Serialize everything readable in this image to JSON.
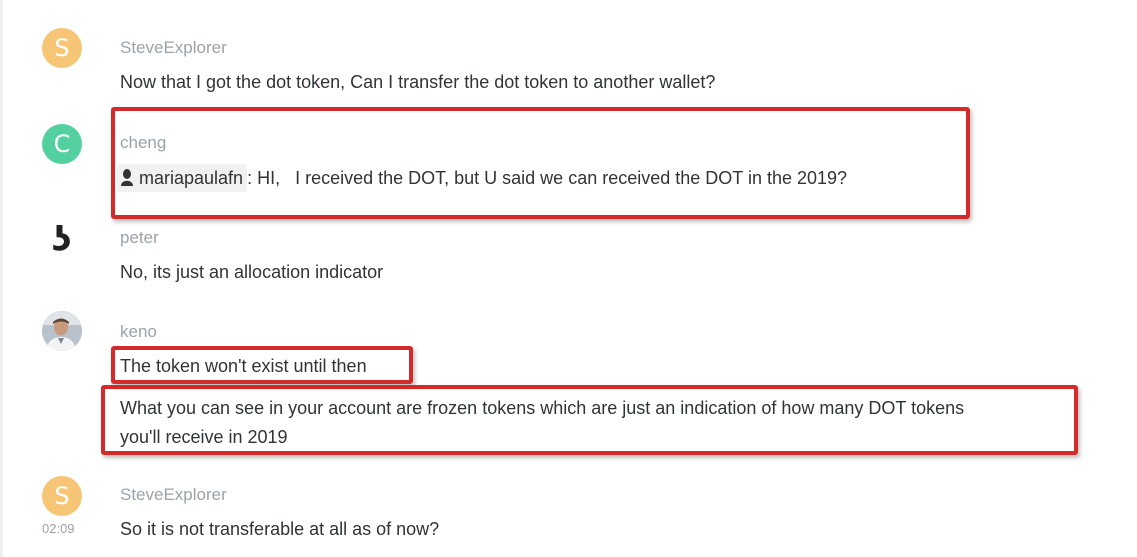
{
  "messages": [
    {
      "user": "SteveExplorer",
      "avatar_letter": "S",
      "lines": [
        "Now that I got the dot token, Can I transfer the dot token to another wallet?"
      ]
    },
    {
      "user": "cheng",
      "avatar_letter": "C",
      "mention": "mariapaulafn",
      "text": ": HI,   I received the DOT, but U said we can received the DOT in the 2019?"
    },
    {
      "user": "peter",
      "avatar_glyph": "ʖ",
      "lines": [
        "No, its just an allocation indicator"
      ]
    },
    {
      "user": "keno",
      "lines": [
        "The token won't exist until then",
        "What you can see in your account are frozen tokens which are just an indication of how many DOT tokens",
        "you'll receive in 2019"
      ]
    },
    {
      "user": "SteveExplorer",
      "avatar_letter": "S",
      "timestamp": "02:09",
      "lines": [
        "So it is not transferable at all as of now?"
      ]
    }
  ],
  "colors": {
    "steve_avatar": "#f6c676",
    "cheng_avatar": "#52d0a0",
    "highlight": "#d42a2a",
    "username": "#9aa3ab",
    "text": "#2f3438"
  }
}
